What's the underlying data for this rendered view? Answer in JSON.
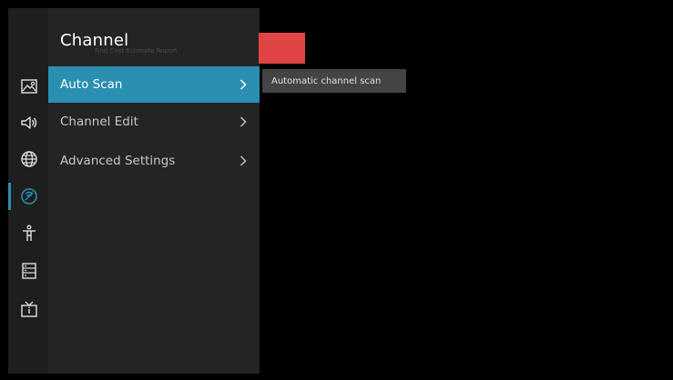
{
  "menu": {
    "title": "Channel",
    "ghost_text": "Find Cost Estimate Report",
    "items": [
      {
        "label": "Auto Scan",
        "active": true
      },
      {
        "label": "Channel Edit",
        "active": false
      },
      {
        "label": "Advanced Settings",
        "active": false
      }
    ]
  },
  "tooltip": {
    "text": "Automatic channel scan"
  },
  "sidebar_icons": [
    "picture-icon",
    "sound-icon",
    "network-icon",
    "channel-icon",
    "accessibility-icon",
    "system-icon",
    "support-icon"
  ],
  "colors": {
    "accent": "#2a8fb1",
    "red_block": "#e04444",
    "menu_bg": "#242424",
    "iconbar_bg": "#1e1e1e",
    "tooltip_bg": "#444444"
  }
}
